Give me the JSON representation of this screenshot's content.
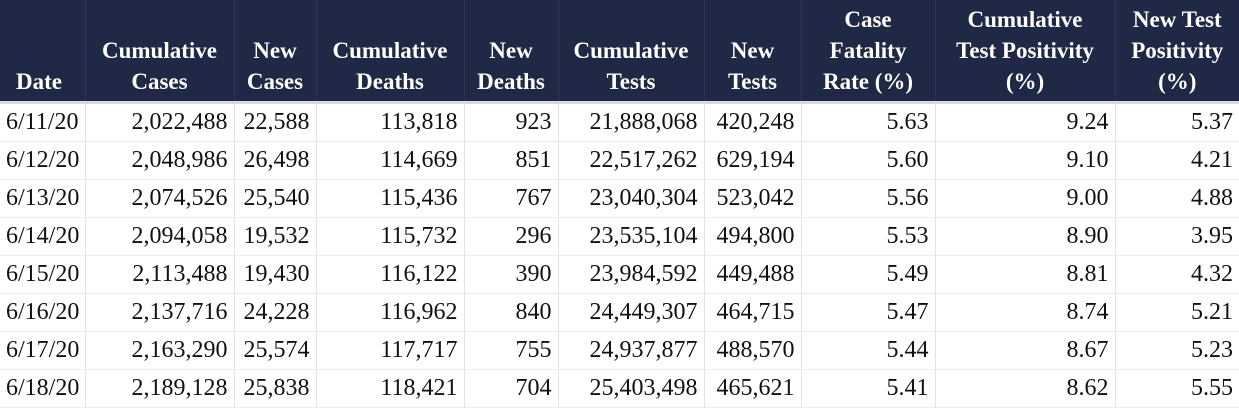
{
  "table": {
    "headers": [
      [
        "Date"
      ],
      [
        "Cumulative",
        "Cases"
      ],
      [
        "New",
        "Cases"
      ],
      [
        "Cumulative",
        "Deaths"
      ],
      [
        "New",
        "Deaths"
      ],
      [
        "Cumulative",
        "Tests"
      ],
      [
        "New",
        "Tests"
      ],
      [
        "Case",
        "Fatality",
        "Rate (%)"
      ],
      [
        "Cumulative",
        "Test Positivity",
        "(%)"
      ],
      [
        "New Test",
        "Positivity",
        "(%)"
      ]
    ],
    "rows": [
      [
        "6/11/20",
        "2,022,488",
        "22,588",
        "113,818",
        "923",
        "21,888,068",
        "420,248",
        "5.63",
        "9.24",
        "5.37"
      ],
      [
        "6/12/20",
        "2,048,986",
        "26,498",
        "114,669",
        "851",
        "22,517,262",
        "629,194",
        "5.60",
        "9.10",
        "4.21"
      ],
      [
        "6/13/20",
        "2,074,526",
        "25,540",
        "115,436",
        "767",
        "23,040,304",
        "523,042",
        "5.56",
        "9.00",
        "4.88"
      ],
      [
        "6/14/20",
        "2,094,058",
        "19,532",
        "115,732",
        "296",
        "23,535,104",
        "494,800",
        "5.53",
        "8.90",
        "3.95"
      ],
      [
        "6/15/20",
        "2,113,488",
        "19,430",
        "116,122",
        "390",
        "23,984,592",
        "449,488",
        "5.49",
        "8.81",
        "4.32"
      ],
      [
        "6/16/20",
        "2,137,716",
        "24,228",
        "116,962",
        "840",
        "24,449,307",
        "464,715",
        "5.47",
        "8.74",
        "5.21"
      ],
      [
        "6/17/20",
        "2,163,290",
        "25,574",
        "117,717",
        "755",
        "24,937,877",
        "488,570",
        "5.44",
        "8.67",
        "5.23"
      ],
      [
        "6/18/20",
        "2,189,128",
        "25,838",
        "118,421",
        "704",
        "25,403,498",
        "465,621",
        "5.41",
        "8.62",
        "5.55"
      ]
    ]
  },
  "colors": {
    "header_background": "#1f2844",
    "header_text": "#ffffff",
    "divider": "#d6dbe6"
  }
}
